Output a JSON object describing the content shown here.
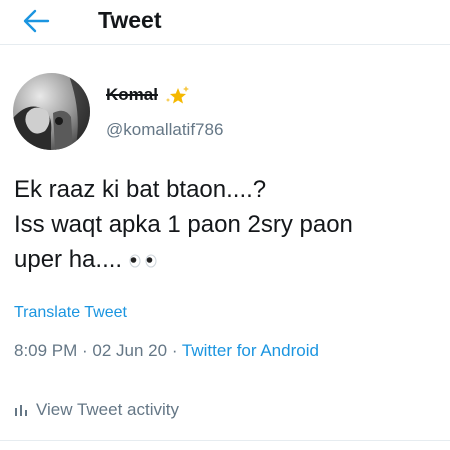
{
  "header": {
    "title": "Tweet",
    "back_icon": "arrow-left-icon",
    "accent_color": "#1b95e0"
  },
  "author": {
    "display_name": "Komal",
    "name_badge_icon": "sparkling-star-icon",
    "handle": "@komallatif786"
  },
  "tweet": {
    "lines": [
      "Ek raaz ki bat btaon....?",
      "Iss waqt apka 1 paon 2sry paon",
      "uper ha...."
    ],
    "trailing_emoji": "eyes-icon"
  },
  "translate_label": "Translate Tweet",
  "meta": {
    "time": "8:09 PM",
    "separator": " · ",
    "date": "02 Jun 20",
    "source": "Twitter for Android"
  },
  "activity": {
    "icon": "bar-chart-icon",
    "label": "View Tweet activity"
  }
}
